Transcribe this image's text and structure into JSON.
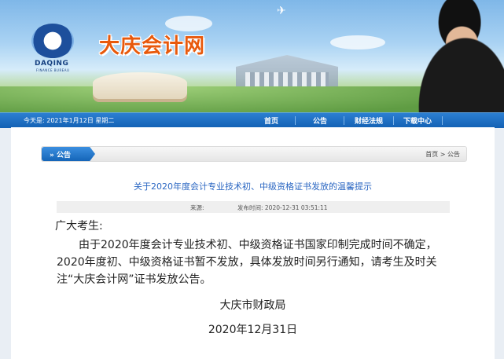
{
  "site": {
    "title": "大庆会计网",
    "logo_en": "DAQING",
    "logo_en_sub": "FINANCE BUREAU",
    "colors": {
      "title_orange": "#e8590c",
      "nav_blue": "#1565b8",
      "link_blue": "#2a66c2"
    }
  },
  "navbar": {
    "date_text": "今天是: 2021年1月12日 星期二",
    "items": [
      {
        "label": "首页"
      },
      {
        "label": "公告"
      },
      {
        "label": "财经法规"
      },
      {
        "label": "下载中心"
      }
    ]
  },
  "breadcrumb": {
    "section": "» 公告",
    "home": "首页",
    "separator": " > ",
    "current": "公告"
  },
  "article": {
    "title": "关于2020年度会计专业技术初、中级资格证书发放的温馨提示",
    "source_label": "来源:",
    "publish_time": "发布时间: 2020-12-31 03:51:11",
    "greeting": "广大考生:",
    "body": "由于2020年度会计专业技术初、中级资格证书国家印制完成时间不确定，2020年度初、中级资格证书暂不发放，具体发放时间另行通知，请考生及时关注“大庆会计网”证书发放公告。",
    "signature_org": "大庆市财政局",
    "signature_date": "2020年12月31日"
  },
  "icons": [
    "logo-mark",
    "plane-icon"
  ]
}
